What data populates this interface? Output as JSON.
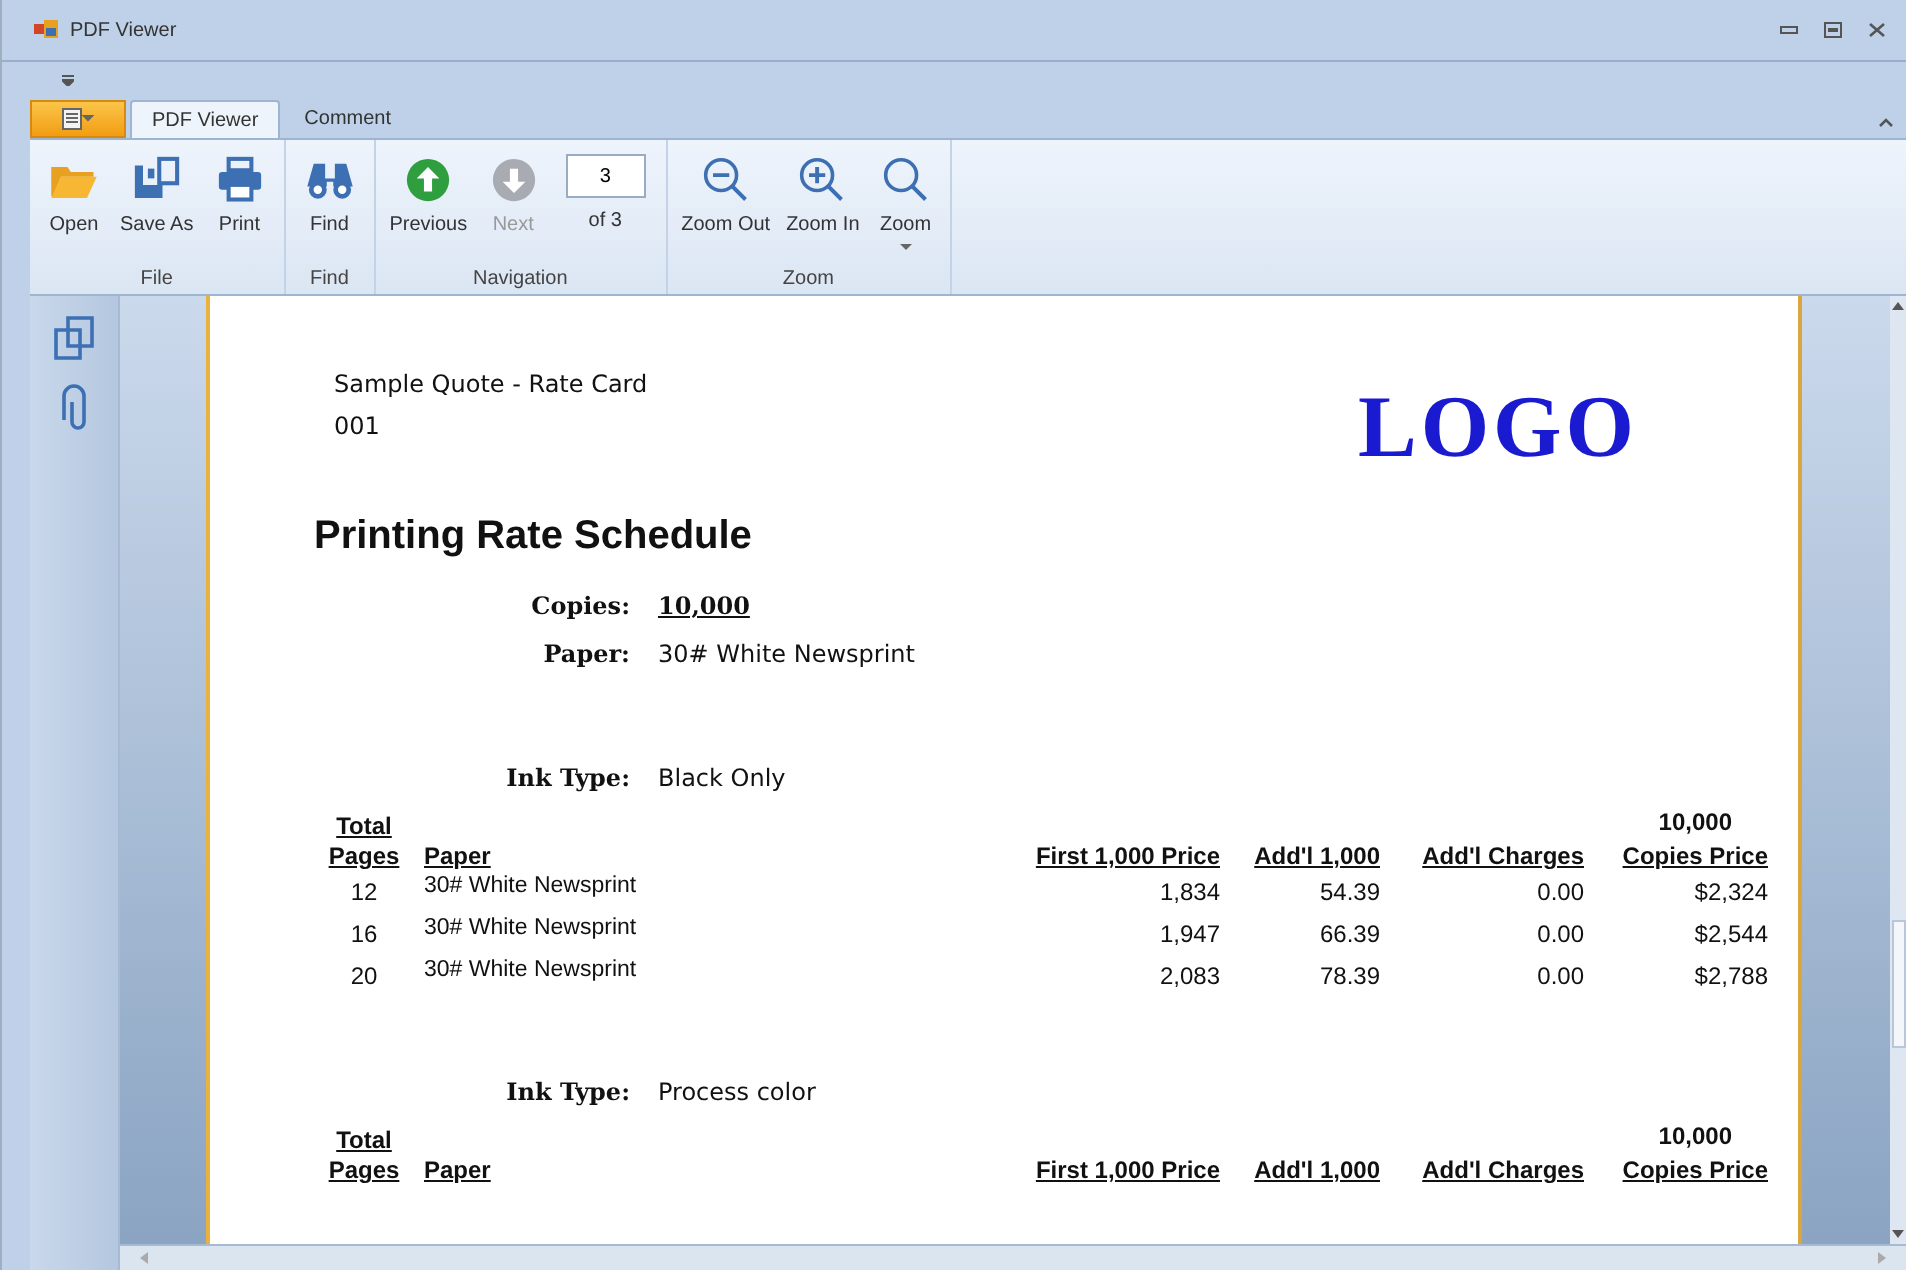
{
  "window": {
    "title": "PDF Viewer"
  },
  "tabs": [
    {
      "label": "PDF Viewer",
      "selected": true
    },
    {
      "label": "Comment",
      "selected": false
    }
  ],
  "ribbon": {
    "groups": [
      {
        "label": "File",
        "items": [
          {
            "kind": "button",
            "label": "Open",
            "disabled": false
          },
          {
            "kind": "button",
            "label": "Save As",
            "disabled": false
          },
          {
            "kind": "button",
            "label": "Print",
            "disabled": false
          }
        ]
      },
      {
        "label": "Find",
        "items": [
          {
            "kind": "button",
            "label": "Find",
            "disabled": false
          }
        ]
      },
      {
        "label": "Navigation",
        "items": [
          {
            "kind": "button",
            "label": "Previous",
            "disabled": false
          },
          {
            "kind": "button",
            "label": "Next",
            "disabled": true
          },
          {
            "kind": "page_field",
            "value": "3",
            "label": "of 3"
          }
        ]
      },
      {
        "label": "Zoom",
        "items": [
          {
            "kind": "button",
            "label": "Zoom Out",
            "disabled": false
          },
          {
            "kind": "button",
            "label": "Zoom In",
            "disabled": false
          },
          {
            "kind": "dropdown",
            "label": "Zoom",
            "disabled": false
          }
        ]
      }
    ]
  },
  "document": {
    "header_lines": [
      "Sample Quote - Rate Card",
      "001"
    ],
    "logo": "LOGO",
    "title": "Printing Rate Schedule",
    "fields": [
      {
        "label": "Copies:",
        "value": "10,000",
        "kind": "emphasis"
      },
      {
        "label": "Paper:",
        "value": "30# White Newsprint",
        "kind": "plain"
      }
    ],
    "sections": [
      {
        "ink_label": "Ink Type:",
        "ink_value": "Black Only",
        "columns": [
          {
            "lines": [
              "Total",
              "Pages"
            ]
          },
          {
            "lines": [
              "Paper"
            ]
          },
          {
            "lines": [
              "First 1,000 Price"
            ]
          },
          {
            "lines": [
              "Add'l 1,000"
            ]
          },
          {
            "lines": [
              "Add'l Charges"
            ]
          },
          {
            "over": "10,000",
            "lines": [
              "Copies Price"
            ]
          }
        ],
        "rows": [
          [
            "12",
            "30# White Newsprint",
            "1,834",
            "54.39",
            "0.00",
            "$2,324"
          ],
          [
            "16",
            "30# White Newsprint",
            "1,947",
            "66.39",
            "0.00",
            "$2,544"
          ],
          [
            "20",
            "30# White Newsprint",
            "2,083",
            "78.39",
            "0.00",
            "$2,788"
          ]
        ]
      },
      {
        "ink_label": "Ink Type:",
        "ink_value": "Process color",
        "columns": [
          {
            "lines": [
              "Total",
              "Pages"
            ]
          },
          {
            "lines": [
              "Paper"
            ]
          },
          {
            "lines": [
              "First 1,000 Price"
            ]
          },
          {
            "lines": [
              "Add'l 1,000"
            ]
          },
          {
            "lines": [
              "Add'l Charges"
            ]
          },
          {
            "over": "10,000",
            "lines": [
              "Copies Price"
            ]
          }
        ]
      }
    ]
  }
}
